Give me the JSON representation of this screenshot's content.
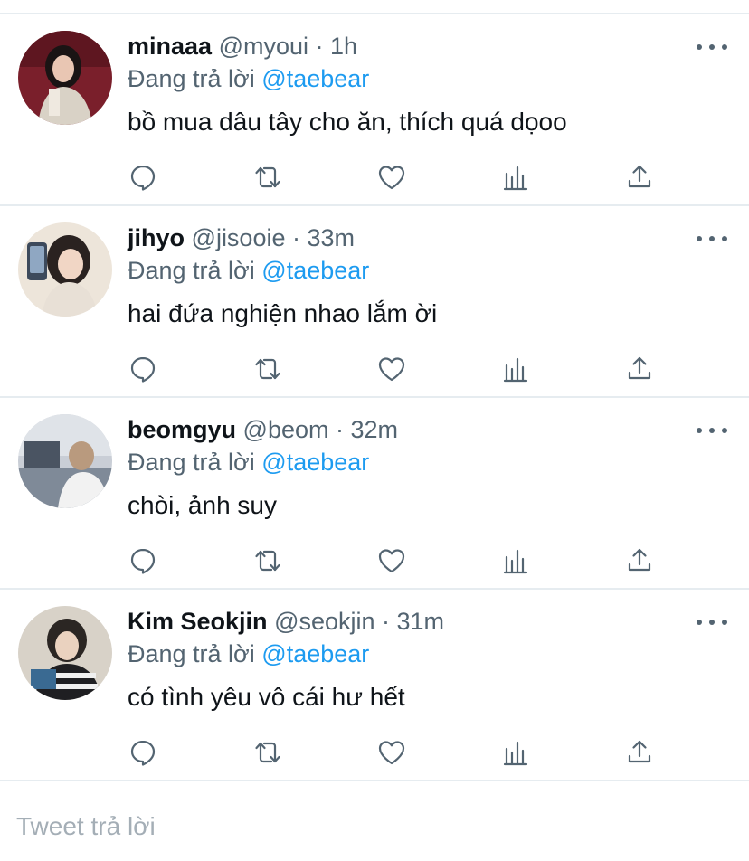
{
  "tweets": [
    {
      "name": "minaaa",
      "meta": "@myoui · 1h",
      "replying_prefix": "Đang trả lời",
      "replying_to": "@taebear",
      "text": "bồ mua dâu tây cho ăn, thích quá dọoo"
    },
    {
      "name": "jihyo",
      "meta": "@jisooie · 33m",
      "replying_prefix": "Đang trả lời",
      "replying_to": "@taebear",
      "text": "hai đứa nghiện nhao lắm ời"
    },
    {
      "name": "beomgyu",
      "meta": "@beom · 32m",
      "replying_prefix": "Đang trả lời",
      "replying_to": "@taebear",
      "text": "chòi, ảnh suy"
    },
    {
      "name": "Kim Seokjin",
      "meta": "@seokjin · 31m",
      "replying_prefix": "Đang trả lời",
      "replying_to": "@taebear",
      "text": "có tình yêu vô cái hư hết"
    }
  ],
  "icons": {
    "reply": "reply-icon",
    "retweet": "retweet-icon",
    "like": "heart-icon",
    "views": "analytics-icon",
    "share": "share-icon",
    "more": "more-icon"
  },
  "colors": {
    "mention": "#1d9bf0",
    "muted": "#536471",
    "divider": "#e6ecf0",
    "placeholder": "#a4aeb6"
  },
  "composer": {
    "placeholder": "Tweet trả lời"
  }
}
